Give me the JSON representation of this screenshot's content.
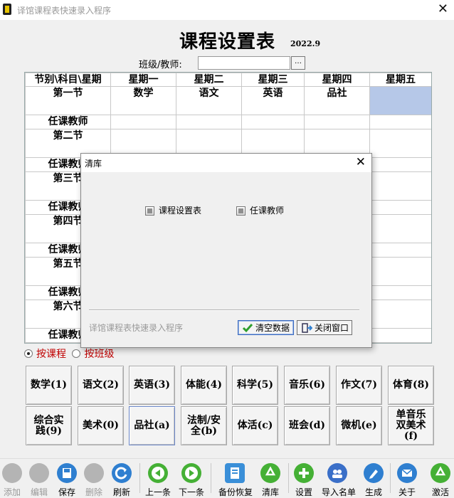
{
  "window": {
    "title": "译馆课程表快速录入程序",
    "close": "✕"
  },
  "page": {
    "title": "课程设置表",
    "year": "2022.9",
    "class_label": "班级/教师:",
    "class_value": "",
    "browse": "…"
  },
  "grid": {
    "headers": [
      "节别\\科目\\星期",
      "星期一",
      "星期二",
      "星期三",
      "星期四",
      "星期五"
    ],
    "rows": [
      {
        "label": "第一节",
        "cells": [
          "数学",
          "语文",
          "英语",
          "品社",
          ""
        ]
      },
      {
        "label": "任课教师",
        "cells": [
          "",
          "",
          "",
          "",
          ""
        ]
      },
      {
        "label": "第二节",
        "cells": [
          "",
          "",
          "",
          "",
          ""
        ]
      },
      {
        "label": "任课教师",
        "cells": [
          "",
          "",
          "",
          "",
          ""
        ]
      },
      {
        "label": "第三节",
        "cells": [
          "",
          "",
          "",
          "",
          ""
        ]
      },
      {
        "label": "任课教师",
        "cells": [
          "",
          "",
          "",
          "",
          ""
        ]
      },
      {
        "label": "第四节",
        "cells": [
          "",
          "",
          "",
          "",
          ""
        ]
      },
      {
        "label": "任课教师",
        "cells": [
          "",
          "",
          "",
          "",
          ""
        ]
      },
      {
        "label": "第五节",
        "cells": [
          "",
          "",
          "",
          "",
          ""
        ]
      },
      {
        "label": "任课教师",
        "cells": [
          "",
          "",
          "",
          "",
          ""
        ]
      },
      {
        "label": "第六节",
        "cells": [
          "",
          "",
          "",
          "",
          ""
        ]
      },
      {
        "label": "任课教师",
        "cells": [
          "",
          "",
          "",
          "",
          ""
        ]
      }
    ]
  },
  "mode": {
    "by_course": "按课程",
    "by_class": "按班级",
    "selected": "by_course"
  },
  "subjects": [
    "数学(1)",
    "语文(2)",
    "英语(3)",
    "体能(4)",
    "科学(5)",
    "音乐(6)",
    "作文(7)",
    "体育(8)",
    "综合实\n践(9)",
    "美术(0)",
    "品社(a)",
    "法制/安\n全(b)",
    "体活(c)",
    "班会(d)",
    "微机(e)",
    "单音乐\n双美术\n(f)"
  ],
  "toolbar": [
    {
      "label": "添加",
      "icon": "person-add-icon",
      "enabled": false,
      "color": "#b4b4b4"
    },
    {
      "label": "编辑",
      "icon": "person-edit-icon",
      "enabled": false,
      "color": "#b4b4b4"
    },
    {
      "label": "保存",
      "icon": "save-icon",
      "enabled": true,
      "color": "#2f7fd0"
    },
    {
      "label": "删除",
      "icon": "person-delete-icon",
      "enabled": false,
      "color": "#b4b4b4"
    },
    {
      "label": "刷新",
      "icon": "refresh-icon",
      "enabled": true,
      "color": "#2f7fd0"
    },
    {
      "label": "上一条",
      "icon": "arrow-left-icon",
      "enabled": true,
      "color": "#45b035"
    },
    {
      "label": "下一条",
      "icon": "arrow-right-icon",
      "enabled": true,
      "color": "#45b035"
    },
    {
      "label": "备份恢复",
      "icon": "backup-icon",
      "enabled": true,
      "color": "#3a8fd8"
    },
    {
      "label": "清库",
      "icon": "recycle-icon",
      "enabled": true,
      "color": "#45b035"
    },
    {
      "label": "设置",
      "icon": "settings-add-icon",
      "enabled": true,
      "color": "#45b035"
    },
    {
      "label": "导入名单",
      "icon": "import-list-icon",
      "enabled": true,
      "color": "#3a6fc8"
    },
    {
      "label": "生成",
      "icon": "pen-icon",
      "enabled": true,
      "color": "#2f7fd0"
    },
    {
      "label": "关于",
      "icon": "mail-icon",
      "enabled": true,
      "color": "#2f7fd0"
    },
    {
      "label": "激活",
      "icon": "recycle-icon",
      "enabled": true,
      "color": "#45b035"
    }
  ],
  "dialog": {
    "title": "清库",
    "close": "✕",
    "option1": "课程设置表",
    "option2": "任课教师",
    "footer": "译馆课程表快速录入程序",
    "clear_button": "清空数据",
    "close_button": "关闭窗口"
  }
}
